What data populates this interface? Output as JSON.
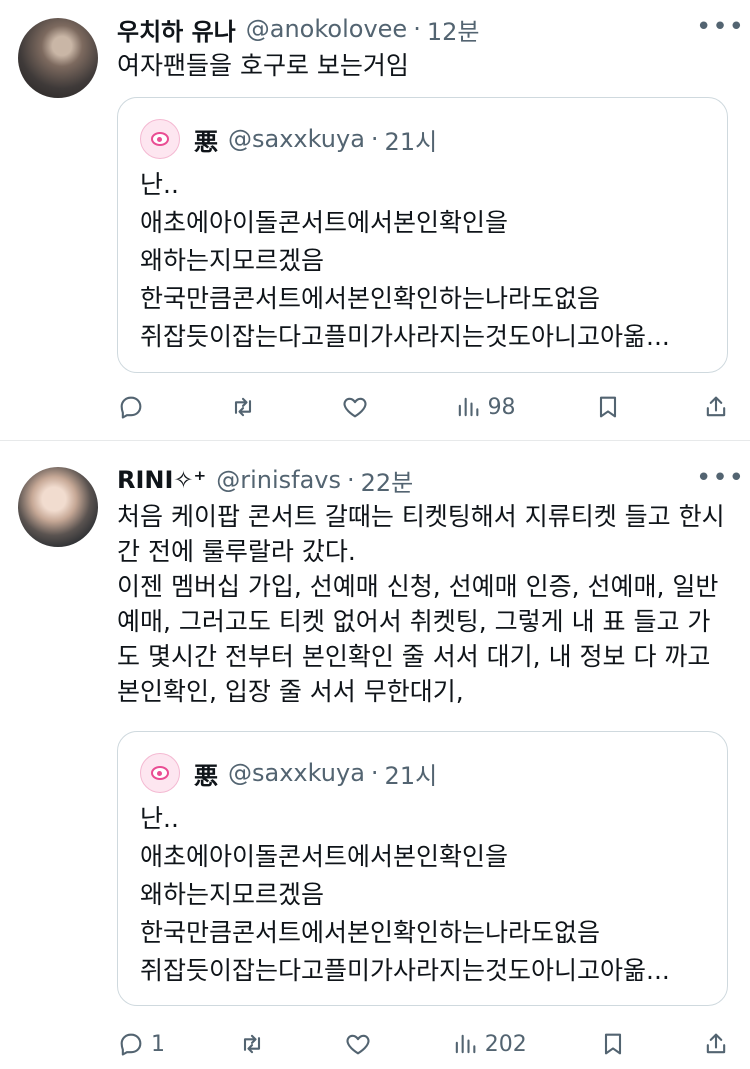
{
  "tweets": [
    {
      "name": "우치하 유나",
      "handle": "@anokolovee",
      "dot": "·",
      "time": "12분",
      "more": "•••",
      "text": "여자팬들을 호구로 보는거임",
      "quote": {
        "name": "悪",
        "handle": "@saxxkuya",
        "dot": "·",
        "time": "21시",
        "text": "난..\n애초에아이돌콘서트에서본인확인을\n왜하는지모르겠음\n한국만큼콘서트에서본인확인하는나라도없음\n쥐잡듯이잡는다고플미가사라지는것도아니고아옮..."
      },
      "actions": {
        "reply": "",
        "retweet": "",
        "like": "",
        "views": "98"
      }
    },
    {
      "name": "RINI✧⁺",
      "handle": "@rinisfavs",
      "dot": "·",
      "time": "22분",
      "more": "•••",
      "text": "처음 케이팝 콘서트 갈때는 티켓팅해서 지류티켓 들고 한시간 전에 룰루랄라 갔다.\n이젠 멤버십 가입, 선예매 신청, 선예매 인증, 선예매, 일반예매, 그러고도 티켓 없어서 취켓팅, 그렇게 내 표 들고 가도 몇시간 전부터 본인확인 줄 서서 대기, 내 정보 다 까고 본인확인, 입장 줄 서서 무한대기,",
      "quote": {
        "name": "悪",
        "handle": "@saxxkuya",
        "dot": "·",
        "time": "21시",
        "text": "난..\n애초에아이돌콘서트에서본인확인을\n왜하는지모르겠음\n한국만큼콘서트에서본인확인하는나라도없음\n쥐잡듯이잡는다고플미가사라지는것도아니고아옮..."
      },
      "actions": {
        "reply": "1",
        "retweet": "",
        "like": "",
        "views": "202"
      }
    }
  ]
}
